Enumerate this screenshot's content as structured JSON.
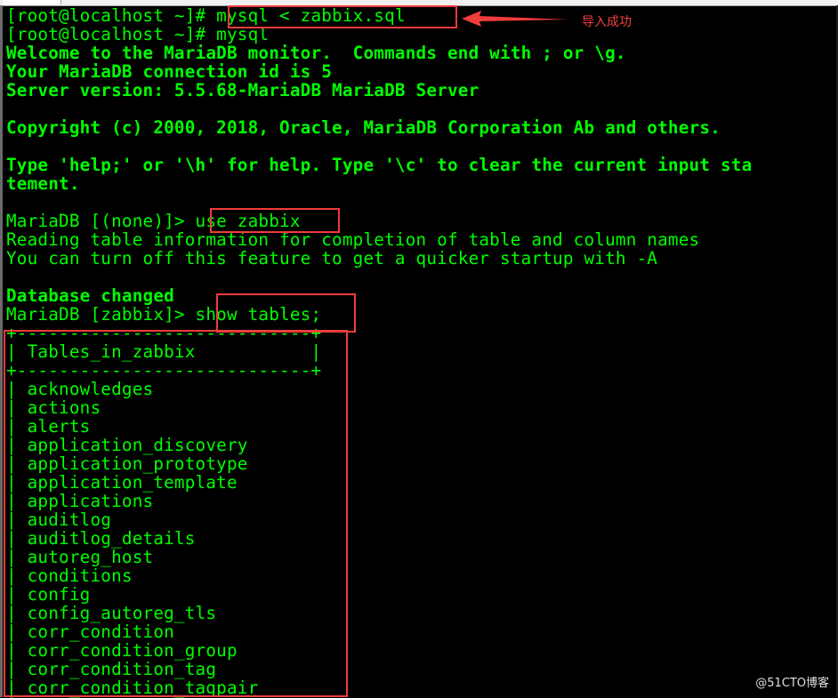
{
  "window": {
    "background_color": "#000000",
    "text_color": "#00ff00",
    "annotation_color": "#f03c3c"
  },
  "terminal": {
    "lines": [
      {
        "text": "[root@localhost ~]# mysql < zabbix.sql",
        "bold": false
      },
      {
        "text": "[root@localhost ~]# mysql",
        "bold": false
      },
      {
        "text": "Welcome to the MariaDB monitor.  Commands end with ; or \\g.",
        "bold": true
      },
      {
        "text": "Your MariaDB connection id is 5",
        "bold": true
      },
      {
        "text": "Server version: 5.5.68-MariaDB MariaDB Server",
        "bold": true
      },
      {
        "text": "",
        "bold": true
      },
      {
        "text": "Copyright (c) 2000, 2018, Oracle, MariaDB Corporation Ab and others.",
        "bold": true
      },
      {
        "text": "",
        "bold": true
      },
      {
        "text": "Type 'help;' or '\\h' for help. Type '\\c' to clear the current input sta",
        "bold": true
      },
      {
        "text": "tement.",
        "bold": true
      },
      {
        "text": "",
        "bold": false
      },
      {
        "text": "MariaDB [(none)]> use zabbix",
        "bold": false
      },
      {
        "text": "Reading table information for completion of table and column names",
        "bold": false
      },
      {
        "text": "You can turn off this feature to get a quicker startup with -A",
        "bold": false
      },
      {
        "text": "",
        "bold": false
      },
      {
        "text": "Database changed",
        "bold": true
      },
      {
        "text": "MariaDB [zabbix]> show tables;",
        "bold": false
      },
      {
        "text": "+----------------------------+",
        "bold": false
      },
      {
        "text": "| Tables_in_zabbix           |",
        "bold": false
      },
      {
        "text": "+----------------------------+",
        "bold": false
      },
      {
        "text": "| acknowledges",
        "bold": false
      },
      {
        "text": "| actions",
        "bold": false
      },
      {
        "text": "| alerts",
        "bold": false
      },
      {
        "text": "| application_discovery",
        "bold": false
      },
      {
        "text": "| application_prototype",
        "bold": false
      },
      {
        "text": "| application_template",
        "bold": false
      },
      {
        "text": "| applications",
        "bold": false
      },
      {
        "text": "| auditlog",
        "bold": false
      },
      {
        "text": "| auditlog_details",
        "bold": false
      },
      {
        "text": "| autoreg_host",
        "bold": false
      },
      {
        "text": "| conditions",
        "bold": false
      },
      {
        "text": "| config",
        "bold": false
      },
      {
        "text": "| config_autoreg_tls",
        "bold": false
      },
      {
        "text": "| corr_condition",
        "bold": false
      },
      {
        "text": "| corr_condition_group",
        "bold": false
      },
      {
        "text": "| corr_condition_tag",
        "bold": false
      },
      {
        "text": "| corr_condition_tagpair",
        "bold": false
      }
    ]
  },
  "annotations": {
    "import_label": "导入成功"
  },
  "watermark": "@51CTO博客"
}
